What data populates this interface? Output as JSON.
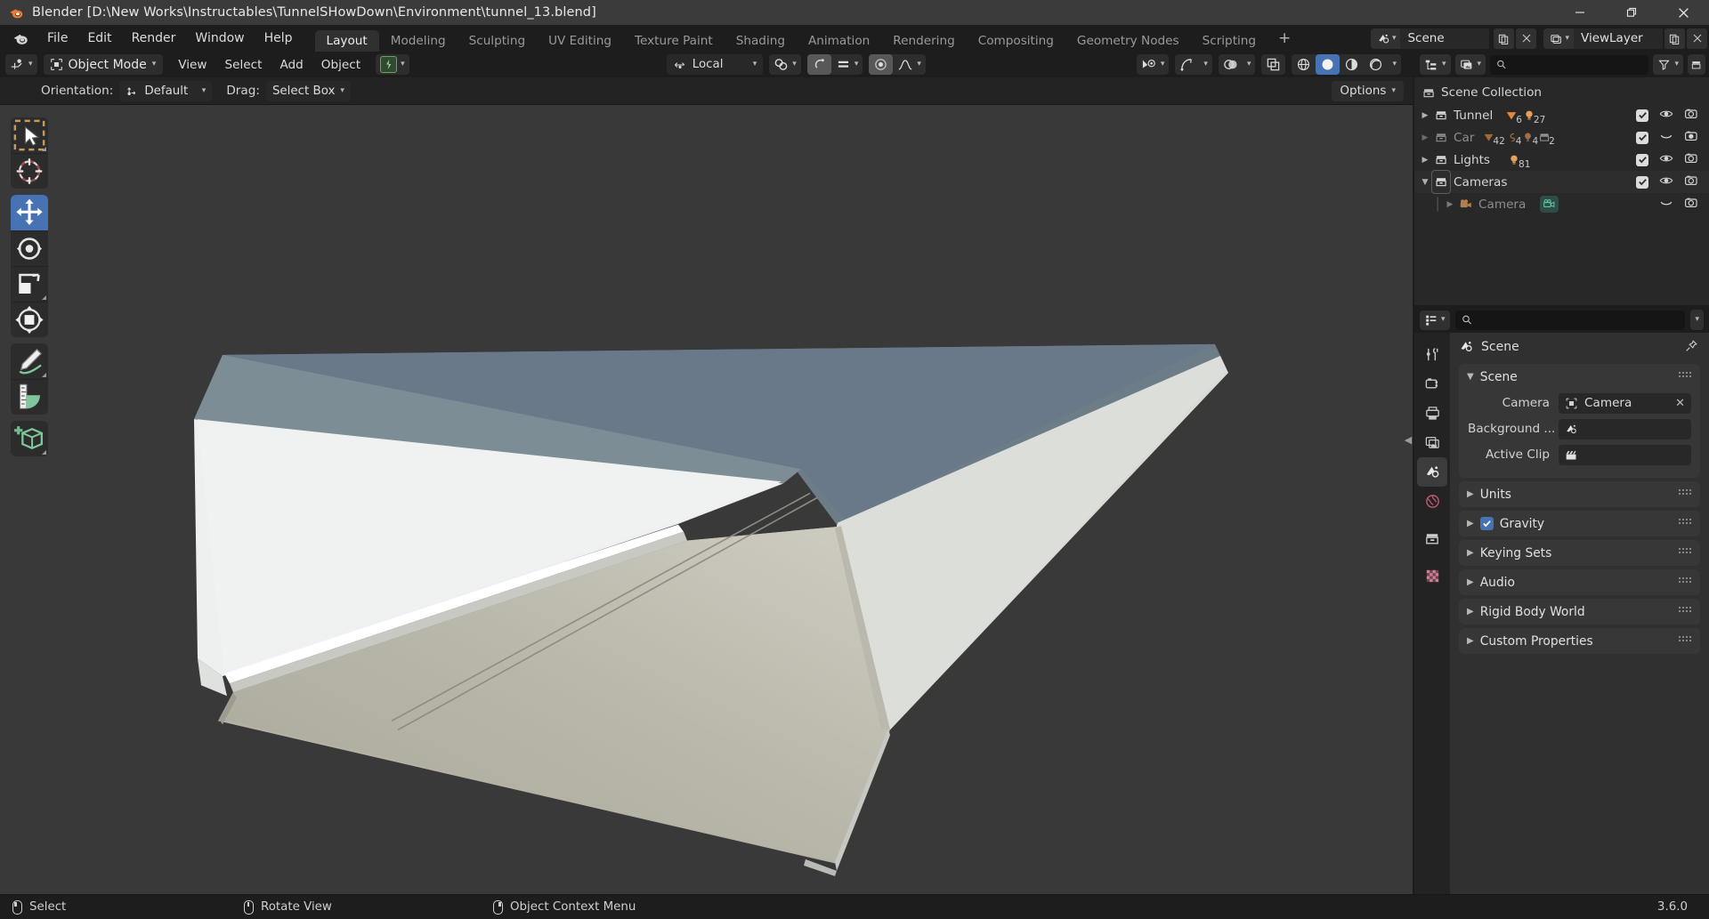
{
  "window": {
    "title": "Blender [D:\\New Works\\Instructables\\TunnelSHowDown\\Environment\\tunnel_13.blend]",
    "minimize": "–",
    "maximize": "❐",
    "close": "✕"
  },
  "topbar": {
    "menus": [
      "File",
      "Edit",
      "Render",
      "Window",
      "Help"
    ],
    "workspaces": [
      {
        "label": "Layout",
        "active": true
      },
      {
        "label": "Modeling",
        "active": false
      },
      {
        "label": "Sculpting",
        "active": false
      },
      {
        "label": "UV Editing",
        "active": false
      },
      {
        "label": "Texture Paint",
        "active": false
      },
      {
        "label": "Shading",
        "active": false
      },
      {
        "label": "Animation",
        "active": false
      },
      {
        "label": "Rendering",
        "active": false
      },
      {
        "label": "Compositing",
        "active": false
      },
      {
        "label": "Geometry Nodes",
        "active": false
      },
      {
        "label": "Scripting",
        "active": false
      }
    ],
    "add_workspace": "+",
    "scene_name": "Scene",
    "view_layer_name": "ViewLayer"
  },
  "viewport_header": {
    "editor_type": "editor-type-3dview",
    "mode": "Object Mode",
    "menus": [
      "View",
      "Select",
      "Add",
      "Object"
    ],
    "transform_orientation": "Local",
    "proportional_editing": "proportional-editing-icon",
    "snapping": "magnet-icon",
    "overlays": "overlays-icon",
    "shading_modes": [
      "wireframe",
      "solid",
      "material-preview",
      "rendered"
    ],
    "active_shading": "solid"
  },
  "viewport_subheader": {
    "orientation_label": "Orientation:",
    "orientation_value": "Default",
    "drag_label": "Drag:",
    "drag_value": "Select Box",
    "options_label": "Options"
  },
  "toolbar": {
    "tools": [
      {
        "name": "tweak-select-tool",
        "active": false
      },
      {
        "name": "cursor-tool",
        "active": false
      },
      {
        "name": "move-tool",
        "active": true
      },
      {
        "name": "rotate-tool",
        "active": false
      },
      {
        "name": "scale-tool",
        "active": false
      },
      {
        "name": "transform-tool",
        "active": false
      },
      {
        "name": "annotate-tool",
        "active": false
      },
      {
        "name": "measure-tool",
        "active": false
      },
      {
        "name": "add-cube-tool",
        "active": false
      }
    ]
  },
  "outliner": {
    "search_placeholder": "",
    "root": "Scene Collection",
    "rows": [
      {
        "label": "Tunnel",
        "type": "collection",
        "expanded": false,
        "indent": 0,
        "dim": false,
        "counts": [
          {
            "icon": "mesh-data",
            "value": "6"
          },
          {
            "icon": "light-data",
            "value": "27"
          }
        ],
        "checkbox": true,
        "eye": "open",
        "camera": "on"
      },
      {
        "label": "Car",
        "type": "collection",
        "expanded": false,
        "indent": 0,
        "dim": true,
        "counts": [
          {
            "icon": "mesh-data",
            "value": "42"
          },
          {
            "icon": "curve-data",
            "value": "4"
          },
          {
            "icon": "light-data",
            "value": "4"
          },
          {
            "icon": "collection-data",
            "value": "2"
          }
        ],
        "checkbox": true,
        "eye": "closed",
        "camera": "on"
      },
      {
        "label": "Lights",
        "type": "collection",
        "expanded": false,
        "indent": 0,
        "dim": false,
        "counts": [
          {
            "icon": "light-data",
            "value": "81"
          }
        ],
        "checkbox": true,
        "eye": "open",
        "camera": "on"
      },
      {
        "label": "Cameras",
        "type": "collection",
        "expanded": true,
        "indent": 0,
        "dim": false,
        "counts": [],
        "checkbox": true,
        "eye": "open",
        "camera": "on"
      },
      {
        "label": "Camera",
        "type": "camera-object",
        "expanded": false,
        "indent": 1,
        "dim": true,
        "counts": [
          {
            "icon": "camera-data",
            "value": ""
          }
        ],
        "checkbox": null,
        "eye": "closed",
        "camera": "on"
      }
    ]
  },
  "properties": {
    "search_placeholder": "",
    "breadcrumb": "Scene",
    "tabs": [
      {
        "name": "tool-tab",
        "active": false
      },
      {
        "name": "render-tab",
        "active": false
      },
      {
        "name": "output-tab",
        "active": false
      },
      {
        "name": "view-layer-tab",
        "active": false
      },
      {
        "name": "scene-tab",
        "active": true
      },
      {
        "name": "world-tab",
        "active": false
      },
      {
        "name": "collection-tab",
        "active": false
      },
      {
        "name": "texture-tab",
        "active": false
      }
    ],
    "scene_panel": {
      "title": "Scene",
      "expanded": true,
      "rows": [
        {
          "label": "Camera",
          "value": "Camera",
          "icon": "camera-data-icon",
          "clearable": true
        },
        {
          "label": "Background ...",
          "value": "",
          "icon": "scene-icon",
          "clearable": false
        },
        {
          "label": "Active Clip",
          "value": "",
          "icon": "clip-icon",
          "clearable": false
        }
      ]
    },
    "collapsed_panels": [
      {
        "title": "Units",
        "checkbox": null
      },
      {
        "title": "Gravity",
        "checkbox": true
      },
      {
        "title": "Keying Sets",
        "checkbox": null
      },
      {
        "title": "Audio",
        "checkbox": null
      },
      {
        "title": "Rigid Body World",
        "checkbox": null
      },
      {
        "title": "Custom Properties",
        "checkbox": null
      }
    ]
  },
  "statusbar": {
    "hints": [
      {
        "mouse": "left",
        "label": "Select"
      },
      {
        "mouse": "mid",
        "label": "Rotate View"
      },
      {
        "mouse": "right",
        "label": "Object Context Menu"
      }
    ],
    "version": "3.6.0"
  },
  "colors": {
    "accent": "#4772b3",
    "viewport_bg": "#393939",
    "panel_bg": "#303030",
    "header_bg": "#1d1d1d",
    "titlebar_bg": "#3b3b3b",
    "model_top": "#6d7e88",
    "model_left": "#eceeed",
    "model_right": "#d7d9d4",
    "model_inner": "#b6b4a6"
  }
}
